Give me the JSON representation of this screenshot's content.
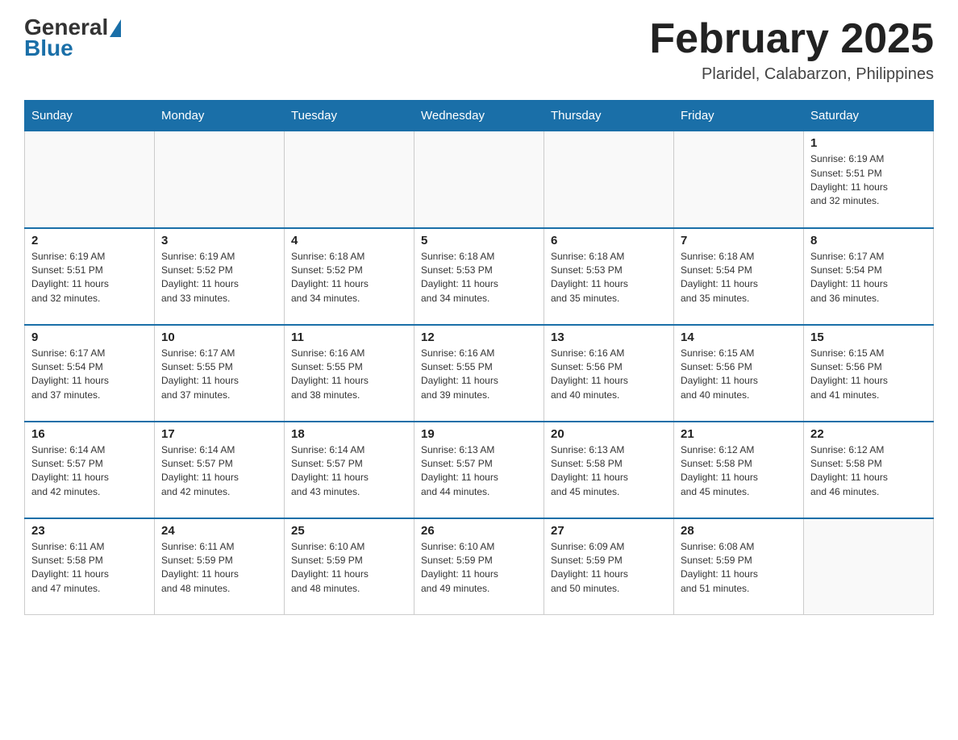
{
  "logo": {
    "general": "General",
    "blue": "Blue"
  },
  "header": {
    "title": "February 2025",
    "subtitle": "Plaridel, Calabarzon, Philippines"
  },
  "days_header": [
    "Sunday",
    "Monday",
    "Tuesday",
    "Wednesday",
    "Thursday",
    "Friday",
    "Saturday"
  ],
  "weeks": [
    {
      "cells": [
        {
          "day": "",
          "info": ""
        },
        {
          "day": "",
          "info": ""
        },
        {
          "day": "",
          "info": ""
        },
        {
          "day": "",
          "info": ""
        },
        {
          "day": "",
          "info": ""
        },
        {
          "day": "",
          "info": ""
        },
        {
          "day": "1",
          "info": "Sunrise: 6:19 AM\nSunset: 5:51 PM\nDaylight: 11 hours\nand 32 minutes."
        }
      ]
    },
    {
      "cells": [
        {
          "day": "2",
          "info": "Sunrise: 6:19 AM\nSunset: 5:51 PM\nDaylight: 11 hours\nand 32 minutes."
        },
        {
          "day": "3",
          "info": "Sunrise: 6:19 AM\nSunset: 5:52 PM\nDaylight: 11 hours\nand 33 minutes."
        },
        {
          "day": "4",
          "info": "Sunrise: 6:18 AM\nSunset: 5:52 PM\nDaylight: 11 hours\nand 34 minutes."
        },
        {
          "day": "5",
          "info": "Sunrise: 6:18 AM\nSunset: 5:53 PM\nDaylight: 11 hours\nand 34 minutes."
        },
        {
          "day": "6",
          "info": "Sunrise: 6:18 AM\nSunset: 5:53 PM\nDaylight: 11 hours\nand 35 minutes."
        },
        {
          "day": "7",
          "info": "Sunrise: 6:18 AM\nSunset: 5:54 PM\nDaylight: 11 hours\nand 35 minutes."
        },
        {
          "day": "8",
          "info": "Sunrise: 6:17 AM\nSunset: 5:54 PM\nDaylight: 11 hours\nand 36 minutes."
        }
      ]
    },
    {
      "cells": [
        {
          "day": "9",
          "info": "Sunrise: 6:17 AM\nSunset: 5:54 PM\nDaylight: 11 hours\nand 37 minutes."
        },
        {
          "day": "10",
          "info": "Sunrise: 6:17 AM\nSunset: 5:55 PM\nDaylight: 11 hours\nand 37 minutes."
        },
        {
          "day": "11",
          "info": "Sunrise: 6:16 AM\nSunset: 5:55 PM\nDaylight: 11 hours\nand 38 minutes."
        },
        {
          "day": "12",
          "info": "Sunrise: 6:16 AM\nSunset: 5:55 PM\nDaylight: 11 hours\nand 39 minutes."
        },
        {
          "day": "13",
          "info": "Sunrise: 6:16 AM\nSunset: 5:56 PM\nDaylight: 11 hours\nand 40 minutes."
        },
        {
          "day": "14",
          "info": "Sunrise: 6:15 AM\nSunset: 5:56 PM\nDaylight: 11 hours\nand 40 minutes."
        },
        {
          "day": "15",
          "info": "Sunrise: 6:15 AM\nSunset: 5:56 PM\nDaylight: 11 hours\nand 41 minutes."
        }
      ]
    },
    {
      "cells": [
        {
          "day": "16",
          "info": "Sunrise: 6:14 AM\nSunset: 5:57 PM\nDaylight: 11 hours\nand 42 minutes."
        },
        {
          "day": "17",
          "info": "Sunrise: 6:14 AM\nSunset: 5:57 PM\nDaylight: 11 hours\nand 42 minutes."
        },
        {
          "day": "18",
          "info": "Sunrise: 6:14 AM\nSunset: 5:57 PM\nDaylight: 11 hours\nand 43 minutes."
        },
        {
          "day": "19",
          "info": "Sunrise: 6:13 AM\nSunset: 5:57 PM\nDaylight: 11 hours\nand 44 minutes."
        },
        {
          "day": "20",
          "info": "Sunrise: 6:13 AM\nSunset: 5:58 PM\nDaylight: 11 hours\nand 45 minutes."
        },
        {
          "day": "21",
          "info": "Sunrise: 6:12 AM\nSunset: 5:58 PM\nDaylight: 11 hours\nand 45 minutes."
        },
        {
          "day": "22",
          "info": "Sunrise: 6:12 AM\nSunset: 5:58 PM\nDaylight: 11 hours\nand 46 minutes."
        }
      ]
    },
    {
      "cells": [
        {
          "day": "23",
          "info": "Sunrise: 6:11 AM\nSunset: 5:58 PM\nDaylight: 11 hours\nand 47 minutes."
        },
        {
          "day": "24",
          "info": "Sunrise: 6:11 AM\nSunset: 5:59 PM\nDaylight: 11 hours\nand 48 minutes."
        },
        {
          "day": "25",
          "info": "Sunrise: 6:10 AM\nSunset: 5:59 PM\nDaylight: 11 hours\nand 48 minutes."
        },
        {
          "day": "26",
          "info": "Sunrise: 6:10 AM\nSunset: 5:59 PM\nDaylight: 11 hours\nand 49 minutes."
        },
        {
          "day": "27",
          "info": "Sunrise: 6:09 AM\nSunset: 5:59 PM\nDaylight: 11 hours\nand 50 minutes."
        },
        {
          "day": "28",
          "info": "Sunrise: 6:08 AM\nSunset: 5:59 PM\nDaylight: 11 hours\nand 51 minutes."
        },
        {
          "day": "",
          "info": ""
        }
      ]
    }
  ]
}
